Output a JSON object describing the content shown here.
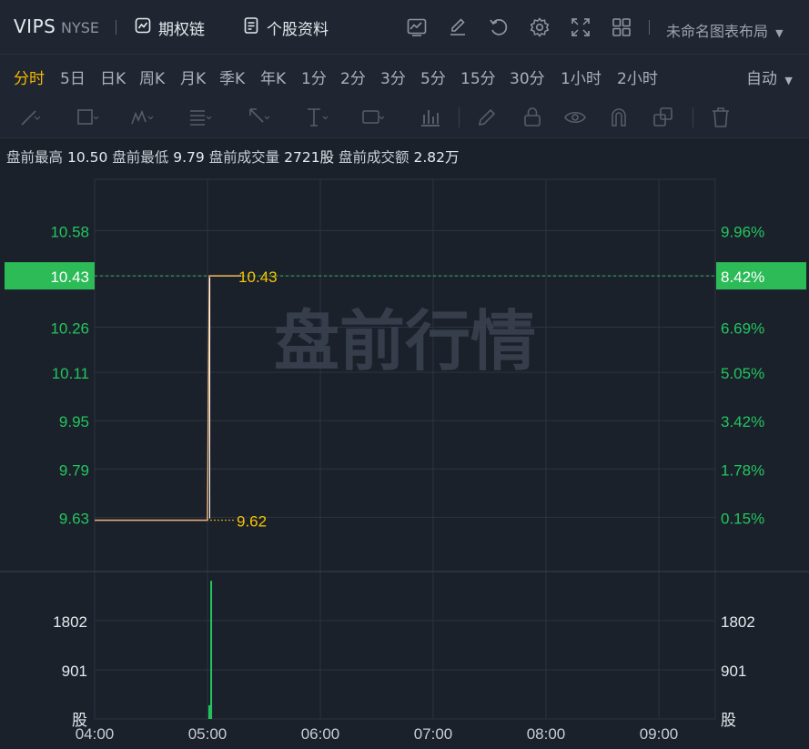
{
  "header": {
    "ticker": "VIPS",
    "exchange": "NYSE",
    "options_chain": "期权链",
    "profile": "个股资料",
    "layout_name": "未命名图表布局"
  },
  "periods": [
    {
      "label": "分时",
      "active": true
    },
    {
      "label": "5日"
    },
    {
      "label": "日K"
    },
    {
      "label": "周K"
    },
    {
      "label": "月K"
    },
    {
      "label": "季K"
    },
    {
      "label": "年K"
    },
    {
      "label": "1分"
    },
    {
      "label": "2分"
    },
    {
      "label": "3分"
    },
    {
      "label": "5分"
    },
    {
      "label": "15分"
    },
    {
      "label": "30分"
    },
    {
      "label": "1小时"
    },
    {
      "label": "2小时"
    }
  ],
  "auto_label": "自动",
  "stats": {
    "high_label": "盘前最高",
    "high": "10.50",
    "low_label": "盘前最低",
    "low": "9.79",
    "vol_label": "盘前成交量",
    "vol": "2721股",
    "amt_label": "盘前成交额",
    "amt": "2.82万"
  },
  "chart_data": {
    "type": "line",
    "watermark": "盘前行情",
    "price_ticks": [
      "10.58",
      "10.43",
      "10.26",
      "10.11",
      "9.95",
      "9.79",
      "9.63"
    ],
    "pct_ticks": [
      "9.96%",
      "8.42%",
      "6.69%",
      "5.05%",
      "3.42%",
      "1.78%",
      "0.15%"
    ],
    "current_price": "10.43",
    "current_pct": "8.42%",
    "ylim": [
      9.45,
      10.75
    ],
    "x_ticks": [
      "04:00",
      "05:00",
      "06:00",
      "07:00",
      "08:00",
      "09:00"
    ],
    "xlim": [
      "04:00",
      "09:30"
    ],
    "series": [
      {
        "x": [
          "04:00",
          "05:00",
          "05:01",
          "05:18"
        ],
        "values": [
          9.62,
          9.62,
          10.43,
          10.43
        ]
      }
    ],
    "annotations": [
      {
        "x": "05:00",
        "y": 9.62,
        "text": "9.62"
      },
      {
        "x": "05:01",
        "y": 10.43,
        "text": "10.43"
      }
    ],
    "volume": {
      "ticks": [
        "1802",
        "901",
        "股"
      ],
      "ylim": [
        0,
        2700
      ],
      "bars": [
        {
          "x": "05:00",
          "value": 250
        },
        {
          "x": "05:01",
          "value": 2530
        }
      ]
    },
    "colors": {
      "price_line": "#f0b37a",
      "up": "#22c55e",
      "label": "#f5c400",
      "grid": "#2c343f",
      "current_bg": "#2cbb57"
    }
  }
}
